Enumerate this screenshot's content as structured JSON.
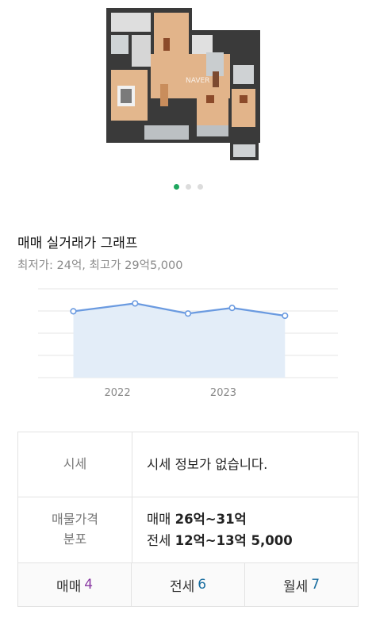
{
  "carousel": {
    "count": 3,
    "active_index": 0,
    "watermark": "NAVER"
  },
  "graph": {
    "title": "매매 실거래가 그래프",
    "subtitle": "최저가: 24억, 최고가 29억5,000"
  },
  "chart_data": {
    "type": "area",
    "title": "매매 실거래가 그래프",
    "x_tick_labels": [
      "2022",
      "2023"
    ],
    "series": [
      {
        "points": [
          {
            "x": "2021-08",
            "y": 27.7
          },
          {
            "x": "2022-03",
            "y": 28.4
          },
          {
            "x": "2022-09",
            "y": 27.5
          },
          {
            "x": "2023-02",
            "y": 28.0
          },
          {
            "x": "2023-08",
            "y": 27.3
          }
        ]
      }
    ],
    "ylim": [
      21.8,
      29.7
    ],
    "grid": true,
    "colors": {
      "line": "#6a9ae0",
      "fill": "#e3edf8",
      "marker_fill": "#ffffff"
    }
  },
  "table": {
    "market_label": "시세",
    "market_value": "시세 정보가 없습니다.",
    "dist_label_line1": "매물가격",
    "dist_label_line2": "분포",
    "sale_prefix": "매매",
    "sale_range": "26억~31억",
    "jeonse_prefix": "전세",
    "jeonse_range": "12억~13억 5,000"
  },
  "tabs": [
    {
      "label": "매매",
      "count": "4",
      "color": "#8a3aa3"
    },
    {
      "label": "전세",
      "count": "6",
      "color": "#1a6ea0"
    },
    {
      "label": "월세",
      "count": "7",
      "color": "#1a6ea0"
    }
  ]
}
